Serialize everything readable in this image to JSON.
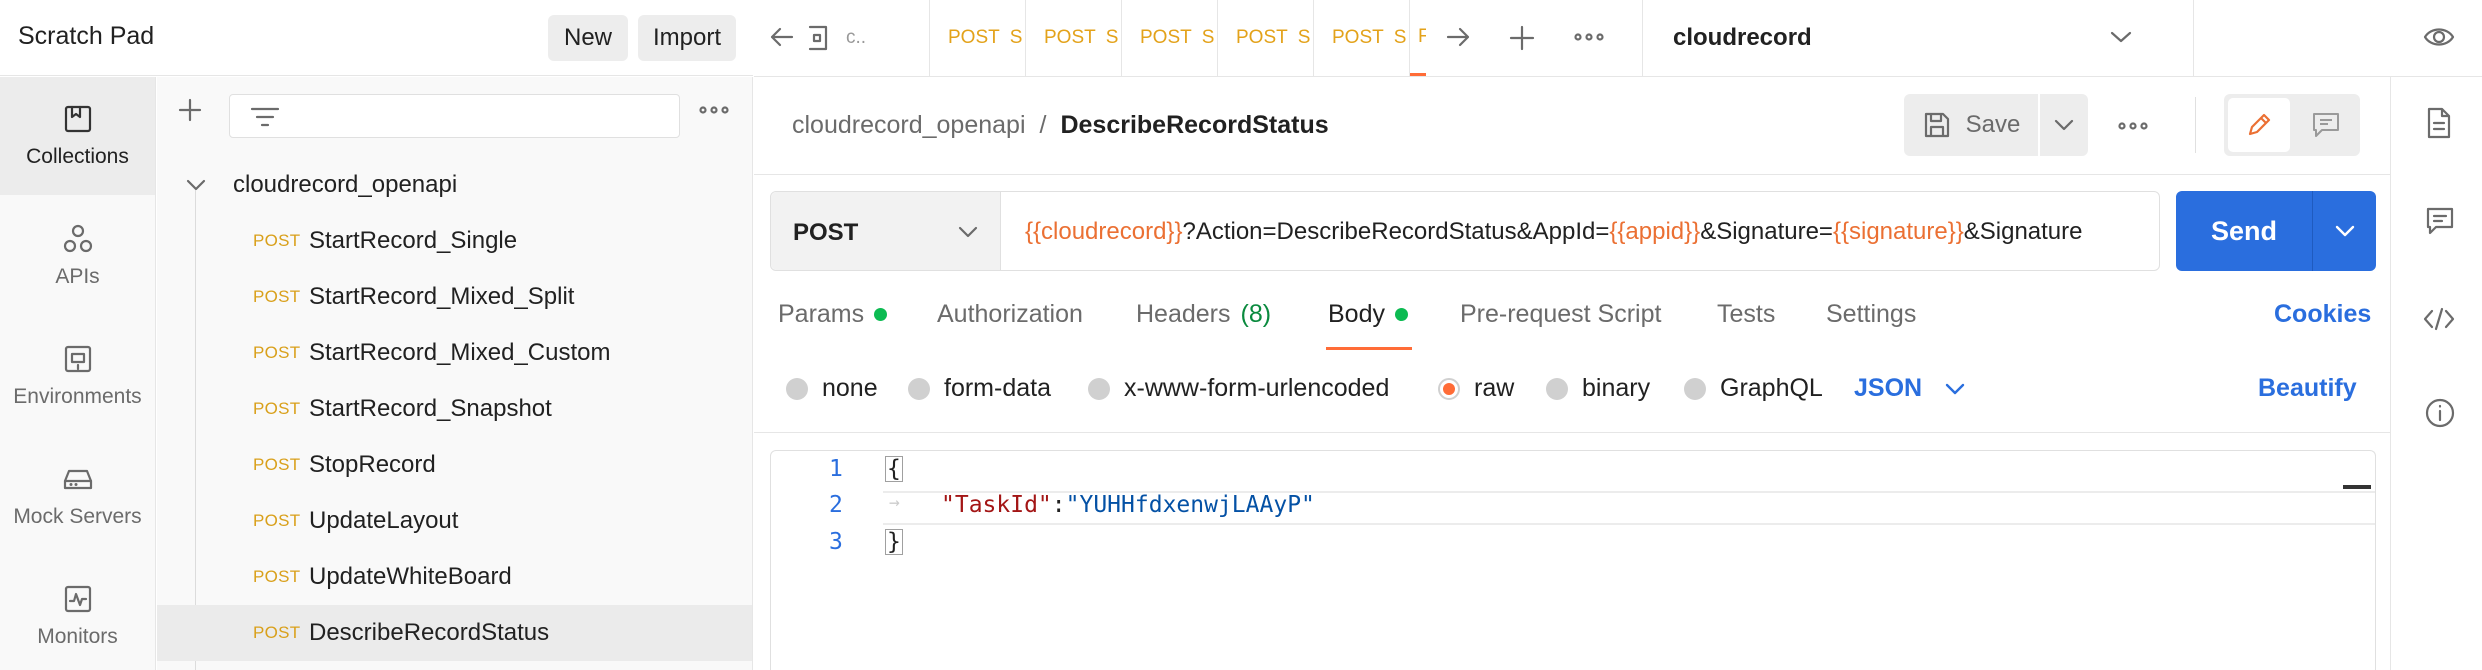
{
  "workspace": {
    "title": "Scratch Pad",
    "new_label": "New",
    "import_label": "Import"
  },
  "rail": {
    "items": [
      {
        "label": "Collections",
        "icon": "collections-icon"
      },
      {
        "label": "APIs",
        "icon": "apis-icon"
      },
      {
        "label": "Environments",
        "icon": "environments-icon"
      },
      {
        "label": "Mock Servers",
        "icon": "mock-servers-icon"
      },
      {
        "label": "Monitors",
        "icon": "monitors-icon"
      }
    ]
  },
  "sidebar": {
    "collection_name": "cloudrecord_openapi",
    "requests": [
      {
        "method": "POST",
        "name": "StartRecord_Single"
      },
      {
        "method": "POST",
        "name": "StartRecord_Mixed_Split"
      },
      {
        "method": "POST",
        "name": "StartRecord_Mixed_Custom"
      },
      {
        "method": "POST",
        "name": "StartRecord_Snapshot"
      },
      {
        "method": "POST",
        "name": "StopRecord"
      },
      {
        "method": "POST",
        "name": "UpdateLayout"
      },
      {
        "method": "POST",
        "name": "UpdateWhiteBoard"
      },
      {
        "method": "POST",
        "name": "DescribeRecordStatus"
      }
    ]
  },
  "tabs": {
    "first_name": "c..",
    "items": [
      {
        "method": "POST",
        "name": "S"
      },
      {
        "method": "POST",
        "name": "S"
      },
      {
        "method": "POST",
        "name": "S"
      },
      {
        "method": "POST",
        "name": "S"
      },
      {
        "method": "POST",
        "name": "S"
      }
    ],
    "partial_method": "F",
    "environment": "cloudrecord"
  },
  "request": {
    "breadcrumb_collection": "cloudrecord_openapi",
    "breadcrumb_sep": "/",
    "name": "DescribeRecordStatus",
    "save_label": "Save",
    "method": "POST",
    "url_parts": [
      {
        "text": "{{cloudrecord}}",
        "var": true
      },
      {
        "text": "?Action=DescribeRecordStatus&AppId=",
        "var": false
      },
      {
        "text": "{{appid}}",
        "var": true
      },
      {
        "text": "&Signature=",
        "var": false
      },
      {
        "text": "{{signature}}",
        "var": true
      },
      {
        "text": "&Signature",
        "var": false
      }
    ],
    "send_label": "Send"
  },
  "request_tabs": {
    "params": "Params",
    "authorization": "Authorization",
    "headers": "Headers",
    "headers_count": "(8)",
    "body": "Body",
    "prerequest": "Pre-request Script",
    "tests": "Tests",
    "settings": "Settings",
    "cookies": "Cookies"
  },
  "body_types": {
    "none": "none",
    "form_data": "form-data",
    "urlencoded": "x-www-form-urlencoded",
    "raw": "raw",
    "binary": "binary",
    "graphql": "GraphQL",
    "format": "JSON",
    "beautify": "Beautify",
    "selected": "raw"
  },
  "editor": {
    "lines": [
      {
        "num": "1",
        "text": "{"
      },
      {
        "num": "2",
        "key": "\"TaskId\"",
        "colon": ":",
        "value": "\"YUHHfdxenwjLAAyP\""
      },
      {
        "num": "3",
        "text": "}"
      }
    ]
  },
  "colors": {
    "accent_blue": "#2a6ede",
    "post_method": "#d9a01b",
    "variable": "#eb7033",
    "json_key": "#a31515",
    "json_value": "#0451a5",
    "status_green": "#0cbb52"
  }
}
